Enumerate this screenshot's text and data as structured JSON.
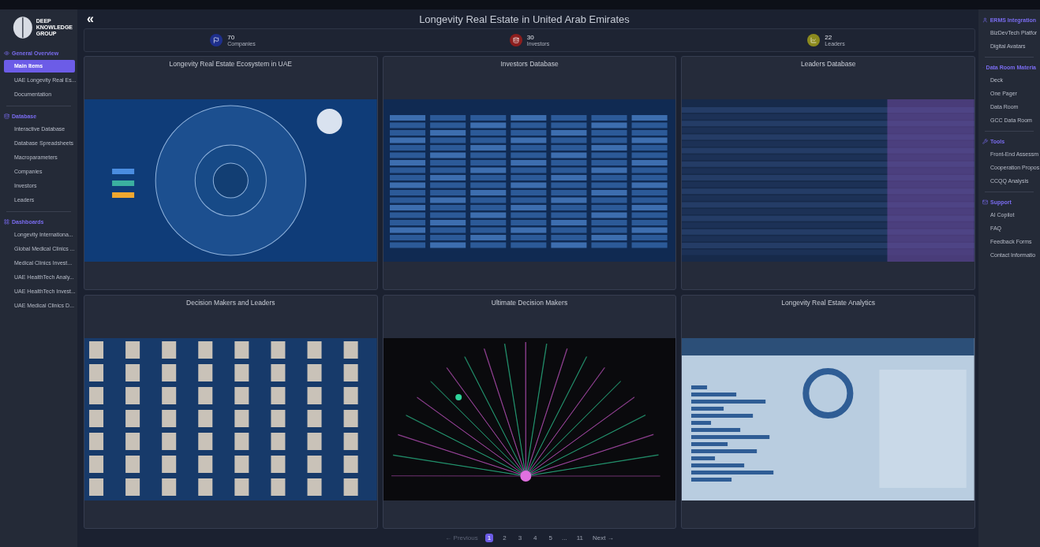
{
  "brand": {
    "name": "DEEP\nKNOWLEDGE\nGROUP"
  },
  "left_sidebar": {
    "sections": [
      {
        "title": "General Overview",
        "items": [
          {
            "label": "Main Items",
            "selected": true
          },
          {
            "label": "UAE Longevity Real Es...",
            "selected": false
          },
          {
            "label": "Documentation",
            "selected": false
          }
        ]
      },
      {
        "title": "Database",
        "items": [
          {
            "label": "Interactive Database",
            "selected": false
          },
          {
            "label": "Database Spreadsheets",
            "selected": false
          },
          {
            "label": "Macroparameters",
            "selected": false
          },
          {
            "label": "Companies",
            "selected": false
          },
          {
            "label": "Investors",
            "selected": false
          },
          {
            "label": "Leaders",
            "selected": false
          }
        ]
      },
      {
        "title": "Dashboards",
        "items": [
          {
            "label": "Longevity Internationa...",
            "selected": false
          },
          {
            "label": "Global Medical Clinics ...",
            "selected": false
          },
          {
            "label": "Medical Clinics Invest...",
            "selected": false
          },
          {
            "label": "UAE HealthTech Analy...",
            "selected": false
          },
          {
            "label": "UAE HealthTech Invest...",
            "selected": false
          },
          {
            "label": "UAE Medical Clinics D...",
            "selected": false
          }
        ]
      }
    ]
  },
  "header": {
    "collapse": "«",
    "title": "Longevity Real Estate in United Arab Emirates"
  },
  "stats": [
    {
      "kind": "flag",
      "value": "70",
      "label": "Companies",
      "color": "#1e2f8c"
    },
    {
      "kind": "database",
      "value": "30",
      "label": "Investors",
      "color": "#8c1e1e"
    },
    {
      "kind": "chart",
      "value": "22",
      "label": "Leaders",
      "color": "#8c8a1e"
    }
  ],
  "cards": [
    {
      "title": "Longevity Real Estate Ecosystem in UAE",
      "kind": "ecosystem"
    },
    {
      "title": "Investors Database",
      "kind": "grid"
    },
    {
      "title": "Leaders Database",
      "kind": "table"
    },
    {
      "title": "Decision Makers and Leaders",
      "kind": "people"
    },
    {
      "title": "Ultimate Decision Makers",
      "kind": "network"
    },
    {
      "title": "Longevity Real Estate Analytics",
      "kind": "analytics"
    }
  ],
  "pagination": {
    "previous": "← Previous",
    "pages": [
      {
        "label": "1",
        "selected": true
      },
      {
        "label": "2",
        "selected": false
      },
      {
        "label": "3",
        "selected": false
      },
      {
        "label": "4",
        "selected": false
      },
      {
        "label": "5",
        "selected": false
      }
    ],
    "ellipsis": "...",
    "last": "11",
    "next": "Next →"
  },
  "right_sidebar": {
    "sections": [
      {
        "title": "ERMS Integration",
        "items": [
          "BizDevTech Platfor",
          "Digital Avatars"
        ]
      },
      {
        "title": "Data Room Materia",
        "items": [
          "Deck",
          "One Pager",
          "Data Room",
          "GCC Data Room"
        ]
      },
      {
        "title": "Tools",
        "items": [
          "Front-End Assessm",
          "Cooperation Propos",
          "CCQQ Analysis"
        ]
      },
      {
        "title": "Support",
        "items": [
          "AI Copilot",
          "FAQ",
          "Feedback Forms",
          "Contact Informatio"
        ]
      }
    ]
  }
}
